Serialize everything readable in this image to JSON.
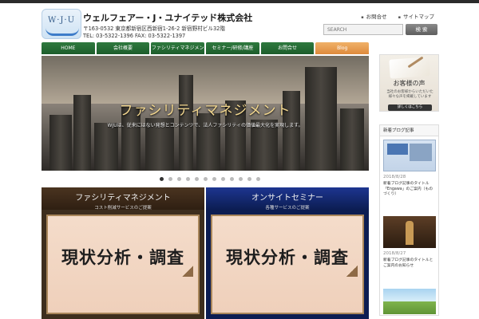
{
  "header": {
    "company_name": "ウェルフェアー・J・ユナイテッド株式会社",
    "logo_text": "W·J·U",
    "address": "〒163-0532 東京都新宿区西新宿1-26-2 新宿野村ビル32階",
    "tel_fax": "TEL: 03-5322-1396 FAX: 03-5322-1397",
    "top_links": [
      "お問合せ",
      "サイトマップ"
    ],
    "search_placeholder": "SEARCH",
    "search_button": "検 索"
  },
  "nav": {
    "items": [
      "HOME",
      "会社概要",
      "ファシリティマネジメント",
      "セミナー/研修/講座",
      "お問合せ",
      "Blog"
    ]
  },
  "hero": {
    "title": "ファシリティマネジメント",
    "subtitle": "WJUは、従来にはない発想とコンテンツで、法人ファシリティの価値最大化を実現します。",
    "slide_count": 12,
    "active_slide": 0
  },
  "cards": [
    {
      "title": "ファシリティマネジメント",
      "subtitle": "コスト削減サービスのご提案",
      "body": "現状分析・調査"
    },
    {
      "title": "オンサイトセミナー",
      "subtitle": "各種サービスのご提案",
      "body": "現状分析・調査"
    }
  ],
  "sidebar": {
    "voice_title": "お客様の声",
    "voice_desc": "当社のお客様からいただいた様々な声を掲載しています",
    "voice_button": "詳しくはこちら",
    "box_title": "新着ブログ記事",
    "posts": [
      {
        "date": "2018/8/28",
        "title": "新着ブログ記事のタイトル「Engawa」のご案内（ものづくり）"
      },
      {
        "date": "2018/8/27",
        "title": "新着ブログ記事のタイトルとご案内のお知らせ"
      }
    ]
  },
  "colors": {
    "nav_green": "#1d5d2b",
    "nav_orange": "#de8a3c",
    "hero_gold": "#f3d78f",
    "card1_head": "#2f1f12",
    "card2_head": "#0c1d52"
  }
}
